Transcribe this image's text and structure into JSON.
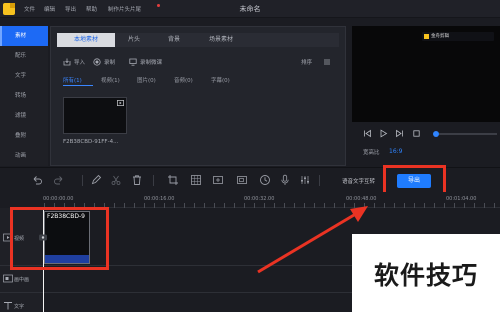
{
  "titlebar": {
    "menu": [
      "文件",
      "编辑",
      "导出",
      "帮助",
      "制作片头片尾"
    ],
    "doc_title": "未命名"
  },
  "left_nav": {
    "items": [
      "素材",
      "配乐",
      "文字",
      "转场",
      "滤镜",
      "叠附",
      "动画"
    ],
    "active": "素材"
  },
  "media": {
    "tabs": [
      "本地素材",
      "片头",
      "背景",
      "场景素材"
    ],
    "active_tab": "本地素材",
    "tools": [
      "导入",
      "录制",
      "录制微课"
    ],
    "sort_label": "排序",
    "filters": [
      "所有(1)",
      "视频(1)",
      "图片(0)",
      "音频(0)",
      "字幕(0)"
    ],
    "active_filter": "所有(1)",
    "clip_name": "F2B38CBD-91FF-4..."
  },
  "preview": {
    "watermark": "金舟剪辑",
    "ratio_label": "宽高比",
    "ratio_value": "16:9"
  },
  "toolbar": {
    "speech_to_text": "语音文字互转",
    "export_label": "导出"
  },
  "timeline": {
    "ruler": [
      "00:00:00.00",
      "00:00:16.00",
      "00:00:32.00",
      "00:00:48.00",
      "00:01:04.00"
    ],
    "tracks": [
      "视频",
      "画中画",
      "文字"
    ],
    "clip_title": "F2B38CBD-9"
  },
  "overlay": {
    "watermark_text": "软件技巧"
  },
  "colors": {
    "accent": "#1f7cff",
    "annotation": "#ea3323",
    "background": "#1b1c22"
  }
}
